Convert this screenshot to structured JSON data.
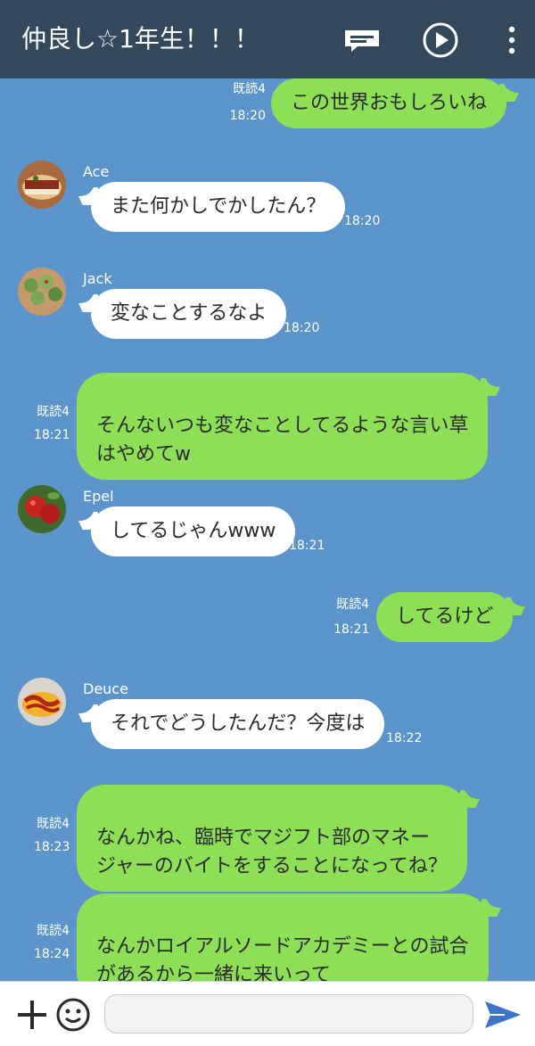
{
  "header": {
    "title": "仲良し☆1年生！！！",
    "icons": [
      "note-icon",
      "play-icon",
      "more-icon"
    ]
  },
  "messages": [
    {
      "direction": "out",
      "text": "この世界おもしろいね",
      "read": "既読4",
      "time": "18:20"
    },
    {
      "direction": "in",
      "sender": "Ace",
      "text": "また何かしでかしたん？",
      "time": "18:20"
    },
    {
      "direction": "in",
      "sender": "Jack",
      "text": "変なことするなよ",
      "time": "18:20"
    },
    {
      "direction": "out",
      "text": "そんないつも変なことしてるような言い草\nはやめてw",
      "read": "既読4",
      "time": "18:21"
    },
    {
      "direction": "in",
      "sender": "Epel",
      "text": "してるじゃんwww",
      "time": "18:21"
    },
    {
      "direction": "out",
      "text": "してるけど",
      "read": "既読4",
      "time": "18:21"
    },
    {
      "direction": "in",
      "sender": "Deuce",
      "text": "それでどうしたんだ？今度は",
      "time": "18:22"
    },
    {
      "direction": "out",
      "text": "なんかね、臨時でマジフト部のマネー\nジャーのバイトをすることになってね？",
      "read": "既読4",
      "time": "18:23"
    },
    {
      "direction": "out",
      "text": "なんかロイアルソードアカデミーとの試合\nがあるから一緒に来いって",
      "read": "既読4",
      "time": "18:24"
    }
  ],
  "input": {
    "value": "",
    "placeholder": ""
  },
  "colors": {
    "background": "#5b95cc",
    "header": "#34485c",
    "out_bubble": "#8de055",
    "in_bubble": "#ffffff",
    "send": "#3d74c8"
  }
}
